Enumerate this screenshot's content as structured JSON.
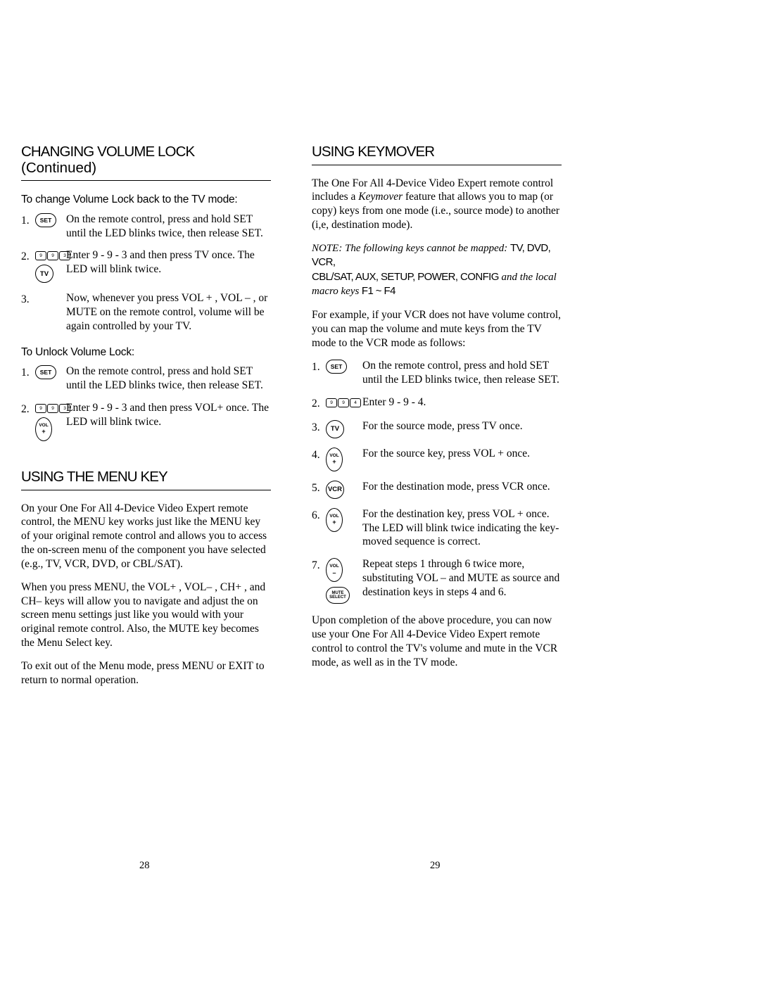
{
  "document": {
    "page_left": "28",
    "page_right": "29"
  },
  "left_column": {
    "heading_main": "CHANGING VOLUME LOCK",
    "heading_cont": " (Continued)",
    "sub1": "To change Volume Lock back to the TV mode:",
    "steps1": [
      {
        "num": "1.",
        "key": "SET",
        "text": "On the remote control, press and hold SET until the LED blinks twice, then release SET."
      },
      {
        "num": "2.",
        "keys": [
          "9",
          "9",
          "3"
        ],
        "key2": "TV",
        "text": "Enter 9 - 9 - 3 and then press TV once. The LED will blink twice."
      },
      {
        "num": "3.",
        "text": "Now, whenever you press VOL + , VOL – , or MUTE on the remote control, volume will be again controlled by your TV."
      }
    ],
    "sub2": "To Unlock Volume Lock:",
    "steps2": [
      {
        "num": "1.",
        "key": "SET",
        "text": "On the remote control, press and hold SET until the LED blinks twice, then release SET."
      },
      {
        "num": "2.",
        "keys": [
          "9",
          "9",
          "3"
        ],
        "key2": "VOL+",
        "text": "Enter 9 - 9 - 3 and then press VOL+ once. The LED will blink twice."
      }
    ],
    "heading2": "USING THE MENU KEY",
    "para1": "On your One For All 4-Device Video Expert remote control, the MENU key works just like the MENU key of your original remote control and allows you to access the on-screen menu of the component you have selected (e.g., TV, VCR,  DVD, or CBL/SAT).",
    "para2": "When you press MENU, the VOL+ , VOL– , CH+ , and CH– keys will allow you to navigate and adjust the on screen menu settings just like you would with your original remote control. Also, the MUTE key becomes the Menu Select key.",
    "para3": "To exit out of the Menu mode, press MENU or EXIT to return to normal operation."
  },
  "right_column": {
    "heading_main": "USING KEYMOVER",
    "para1_a": "The One For All 4-Device Video Expert remote control includes a ",
    "para1_ital": "Keymover",
    "para1_b": " feature that allows you to map (or copy) keys from one mode (i.e., source mode) to another (i,e, destination mode).",
    "note_lead": "NOTE: The following keys cannot be mapped: ",
    "note_keys1": "TV, DVD, VCR,",
    "note_keys2": "CBL/SAT, AUX, SETUP, POWER, CONFIG",
    "note_mid": " and the ",
    "note_ital": "local macro keys",
    "note_keys3": " F1 ~ F4",
    "para2": "For example, if your VCR does not have volume control, you can map the volume and mute keys from the TV mode to the VCR mode as follows:",
    "steps": [
      {
        "num": "1.",
        "key": "SET",
        "text": "On the remote control, press and hold SET until the LED blinks twice, then release SET."
      },
      {
        "num": "2.",
        "keys": [
          "9",
          "9",
          "4"
        ],
        "text": "Enter 9 - 9 - 4."
      },
      {
        "num": "3.",
        "key": "TV",
        "text": "For the source mode, press TV once."
      },
      {
        "num": "4.",
        "key": "VOL+",
        "text": "For the source key, press VOL + once."
      },
      {
        "num": "5.",
        "key": "VCR",
        "text": "For the destination mode, press VCR once."
      },
      {
        "num": "6.",
        "key": "VOL+",
        "text": "For the destination key, press VOL + once. The LED will blink twice indicating the key-moved sequence is correct."
      },
      {
        "num": "7.",
        "key": "VOL-",
        "key2": "MUTE/SELECT",
        "text": "Repeat steps 1 through 6 twice more, substituting VOL – and MUTE as source and destination keys in steps 4 and 6."
      }
    ],
    "para3": "Upon completion of the above procedure, you can now use your One For All 4-Device Video Expert remote control to control the TV's volume and mute in the VCR mode, as well as in the TV mode."
  },
  "key_labels": {
    "set": "SET",
    "tv": "TV",
    "vcr": "VCR",
    "vol": "VOL",
    "plus": "+",
    "minus": "–",
    "mute": "MUTE",
    "select": "SELECT"
  }
}
